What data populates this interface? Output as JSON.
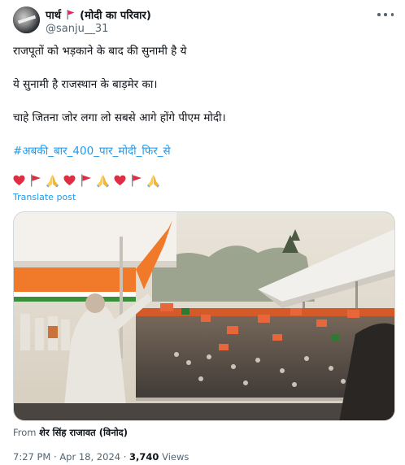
{
  "tweet": {
    "author": {
      "display_name": "पार्थ",
      "display_name_suffix": "(मोदी का परिवार)",
      "handle": "@sanju__31"
    },
    "more_icon": "more-horizontal-icon",
    "lines": [
      "राजपूतों को भड़काने के बाद की सुनामी है ये",
      "ये सुनामी है राजस्थान के बाड़मेर का।",
      "चाहे जितना जोर लगा लो सबसे आगे होंगे पीएम मोदी।"
    ],
    "hashtag": "#अबकी_बार_400_पार_मोदी_फिर_से",
    "emojis": [
      "red-heart",
      "triangular-flag",
      "folded-hands",
      "red-heart",
      "triangular-flag",
      "folded-hands",
      "red-heart",
      "triangular-flag",
      "folded-hands"
    ],
    "translate_label": "Translate post",
    "media": {
      "kind": "video-thumbnail",
      "description_icon": "rally-video-thumbnail"
    },
    "from_label": "From",
    "from_source": "शेर सिंह राजावत (विनोद)",
    "time": "7:27 PM",
    "date": "Apr 18, 2024",
    "views_count": "3,740",
    "views_label": "Views",
    "separator": "·"
  },
  "colors": {
    "text": "#0f1419",
    "secondary": "#536471",
    "link": "#1d9bf0",
    "flag_red": "#e0245e",
    "saffron": "#f4a300"
  }
}
